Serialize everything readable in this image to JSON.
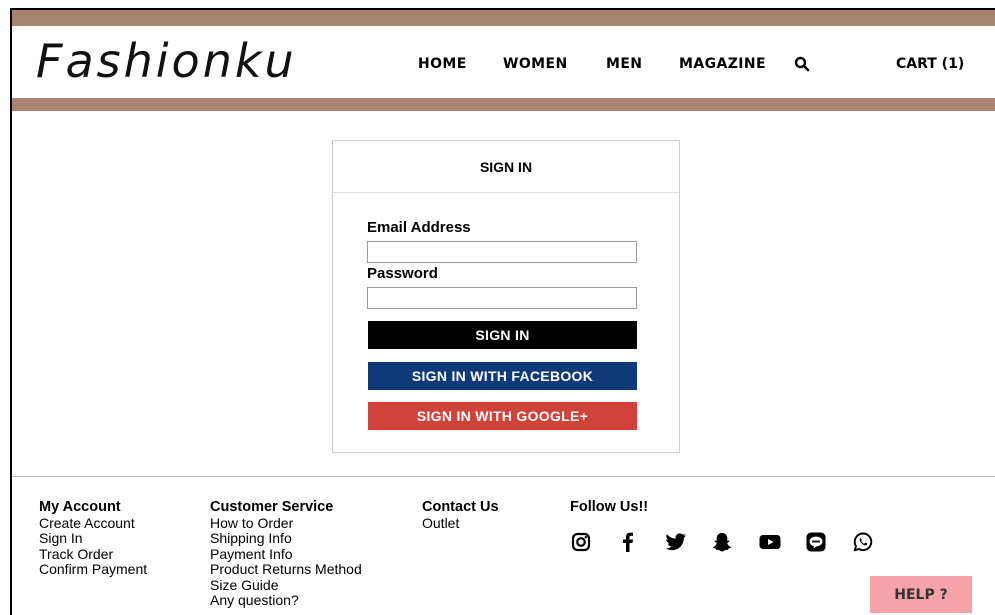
{
  "brand": {
    "logo": "Fashionku",
    "accent": "#a98470"
  },
  "nav": [
    {
      "label": "HOME"
    },
    {
      "label": "WOMEN"
    },
    {
      "label": "MEN"
    },
    {
      "label": "MAGAZINE"
    }
  ],
  "header": {
    "search_icon": "search-icon",
    "cart_label": "CART (1)"
  },
  "signin": {
    "title": "SIGN IN",
    "email_label": "Email Address",
    "email_value": "",
    "password_label": "Password",
    "password_value": "",
    "signin_button": "SIGN IN",
    "facebook_button": "SIGN IN WITH FACEBOOK",
    "google_button": "SIGN IN WITH GOOGLE+",
    "colors": {
      "signin": "#000000",
      "facebook": "#0f3a7a",
      "google": "#d0433a"
    }
  },
  "footer": {
    "my_account": {
      "heading": "My Account",
      "links": [
        "Create Account",
        "Sign In",
        "Track Order",
        "Confirm Payment"
      ]
    },
    "customer_service": {
      "heading": "Customer Service",
      "links": [
        "How to Order",
        "Shipping Info",
        "Payment Info",
        "Product Returns Method",
        "Size Guide",
        "Any question?"
      ]
    },
    "contact_us": {
      "heading": "Contact Us",
      "links": [
        "Outlet"
      ]
    },
    "follow_us": {
      "heading": "Follow Us!!",
      "icons": [
        "instagram-icon",
        "facebook-icon",
        "twitter-icon",
        "snapchat-icon",
        "youtube-icon",
        "line-icon",
        "whatsapp-icon"
      ]
    }
  },
  "help": {
    "label": "HELP ?",
    "color": "#f5a3a8"
  }
}
